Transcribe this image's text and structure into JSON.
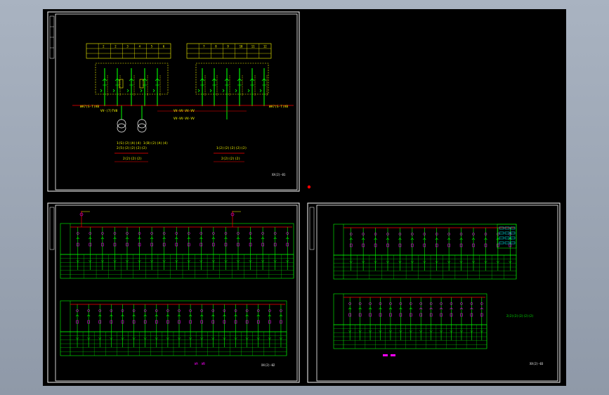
{
  "colors": {
    "viewport_bg": "#a9b3c1",
    "drawing_bg": "#000000",
    "frame": "#ffffff",
    "busbar": "#ff0000",
    "feeder": "#00ff00",
    "device": "#ff00ff",
    "text": "#ffff00",
    "cyan": "#00ffff"
  },
  "sheet1": {
    "table_left": [
      "2",
      "2",
      "3",
      "4",
      "5",
      "6"
    ],
    "table_right": [
      "7",
      "8",
      "9",
      "10",
      "11",
      "12"
    ],
    "bus_label_left": "WA7(S-T)VB",
    "bus_label_right": "WA7(S-T)VB",
    "feeder_labels": [
      "VV-(7)TV8",
      "VV-VV-VV-VV",
      "VV-VV-VV-VV"
    ],
    "transformer_note": "1(S)(2)(A)(4) 1(B)(2)(A)(4)",
    "transformer_sub": "2(5)(2)(2)(2)(2)",
    "right_note": "1(2)(2)(2)(2)(2)",
    "under_left": "2(2)(2)(2)",
    "under_right": "2(2)(2)(2)",
    "title_block": "XX(2)-01"
  },
  "sheet2": {
    "title_block": "XX(2)-02",
    "mid_marks": [
      "WA",
      "WB"
    ]
  },
  "sheet3": {
    "title_block": "XX(2)-03",
    "note": "2(2)(2)(2)(2)(2)"
  }
}
